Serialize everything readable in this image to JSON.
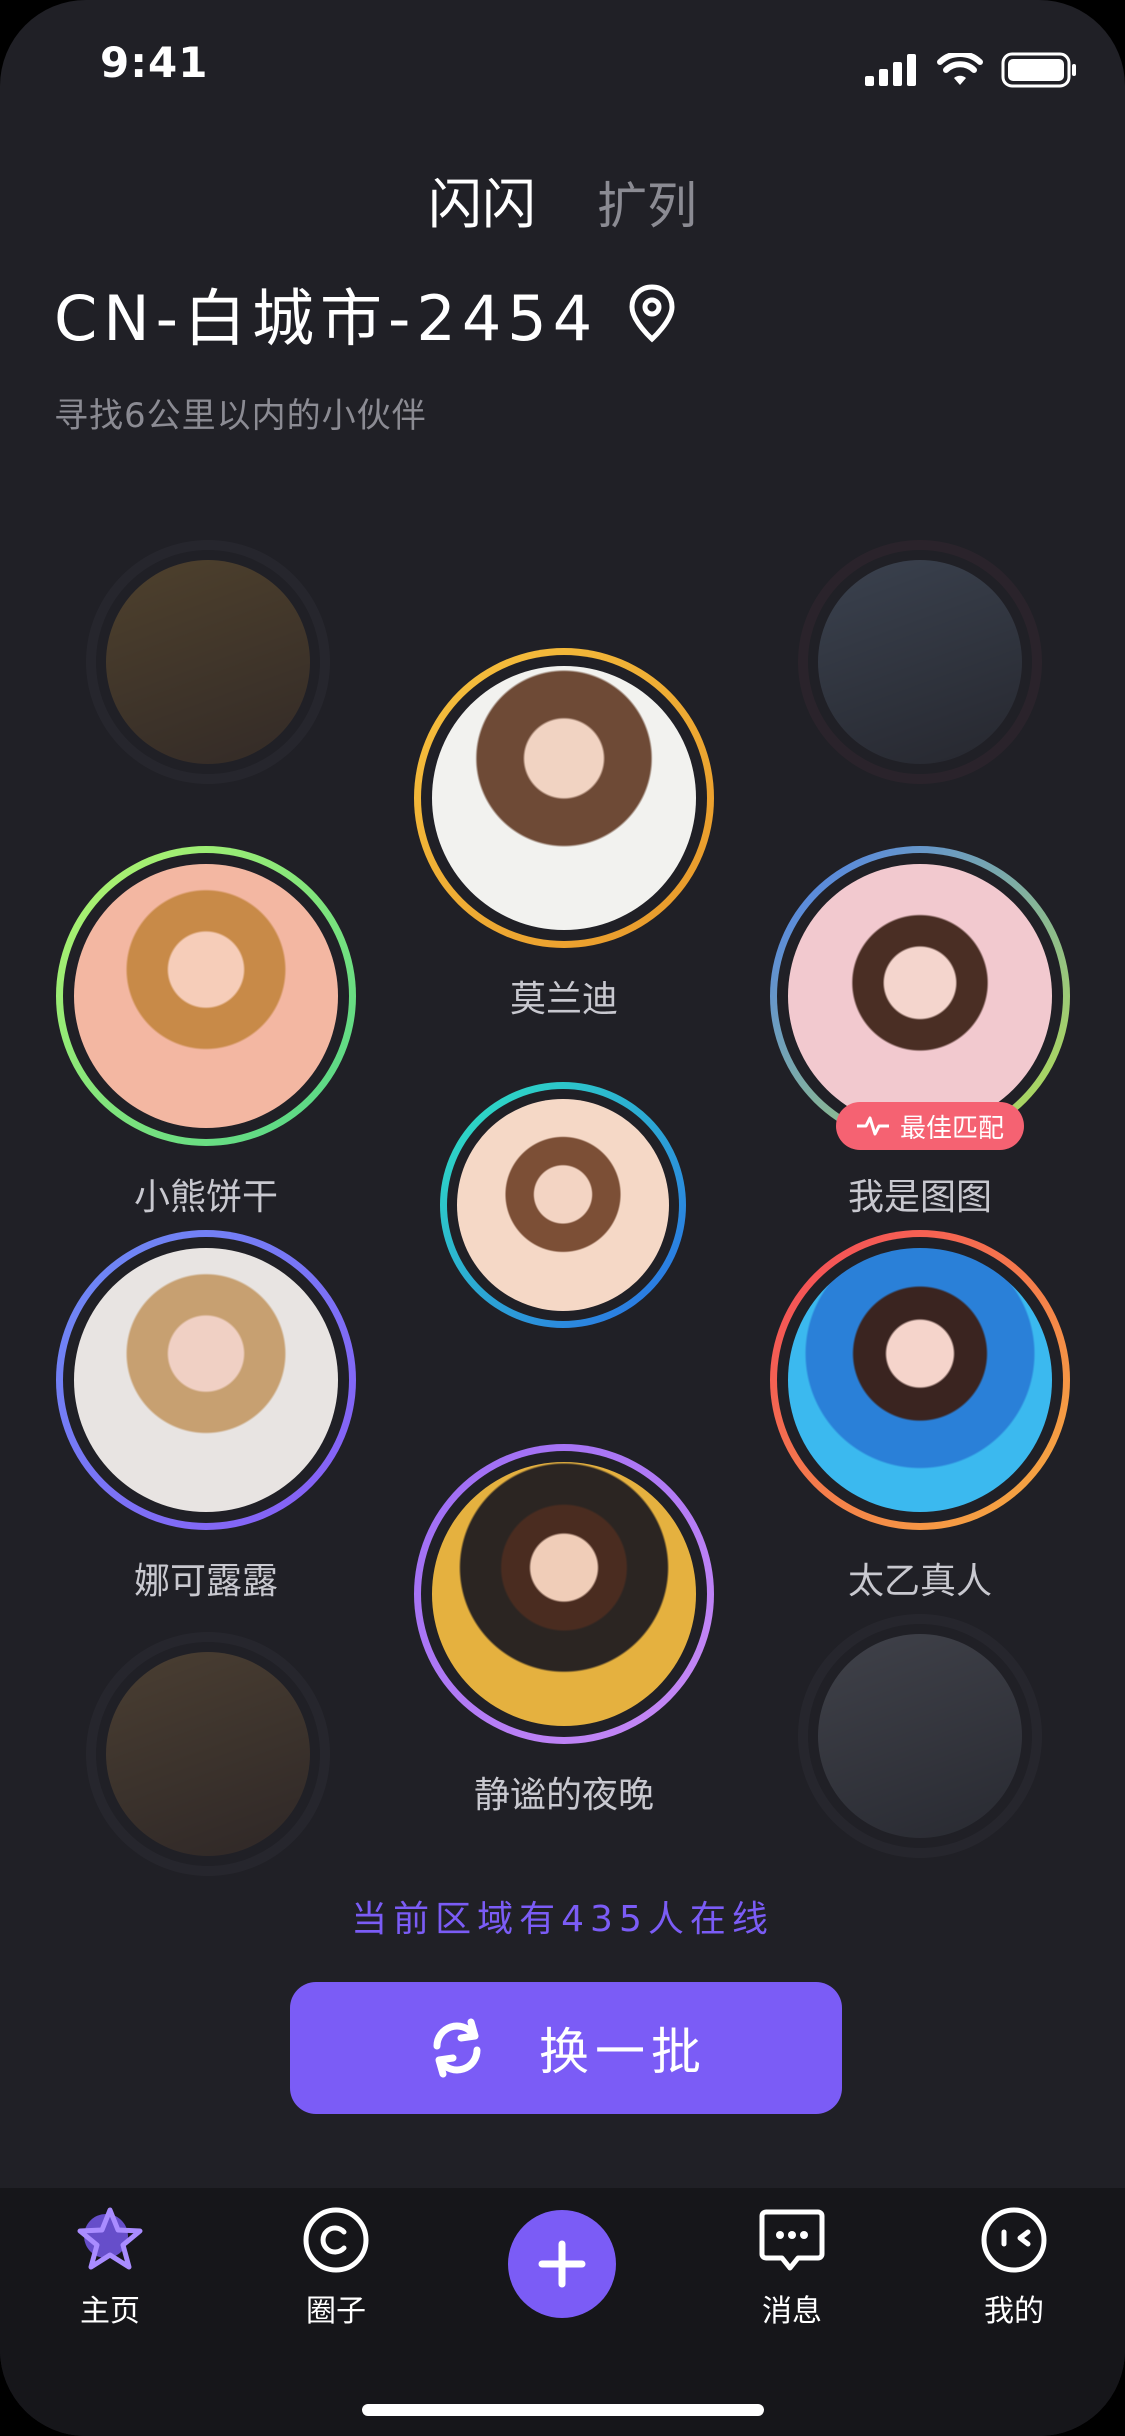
{
  "status_bar": {
    "time": "9:41"
  },
  "tabs": [
    {
      "label": "闪闪"
    },
    {
      "label": "扩列"
    }
  ],
  "location": {
    "title": "CN-白城市-2454",
    "subtitle": "寻找6公里以内的小伙伴"
  },
  "users": [
    {
      "name": "莫兰迪"
    },
    {
      "name": "小熊饼干"
    },
    {
      "name": "我是图图",
      "badge": "最佳匹配"
    },
    {
      "name": "娜可露露"
    },
    {
      "name": "太乙真人"
    },
    {
      "name": "静谧的夜晚"
    }
  ],
  "online_text": "当前区域有435人在线",
  "refresh_button": {
    "label": "换一批"
  },
  "nav": [
    {
      "label": "主页",
      "icon": "star-icon"
    },
    {
      "label": "圈子",
      "icon": "circle-icon"
    },
    {
      "label": "",
      "icon": "plus-icon"
    },
    {
      "label": "消息",
      "icon": "chat-bubble-icon"
    },
    {
      "label": "我的",
      "icon": "face-icon"
    }
  ],
  "colors": {
    "accent": "#7b5cf6",
    "badge": "#f56272",
    "background": "#202026"
  }
}
